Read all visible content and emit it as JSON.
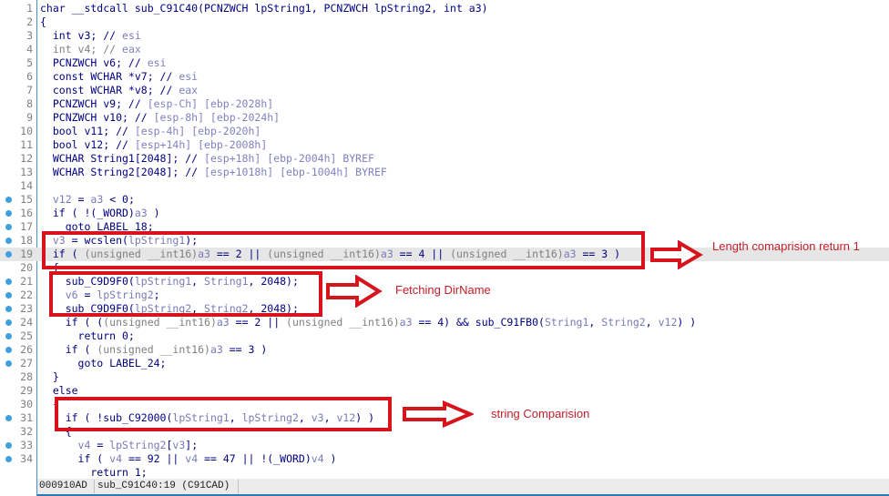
{
  "editor": {
    "lines": [
      {
        "n": "1",
        "bp": false,
        "hl": false,
        "parts": [
          [
            "kw",
            "char __stdcall sub_C91C40(PCNZWCH lpString1, PCNZWCH lpString2, int a3)"
          ]
        ]
      },
      {
        "n": "2",
        "bp": false,
        "hl": false,
        "parts": [
          [
            "kw",
            "{"
          ]
        ]
      },
      {
        "n": "3",
        "bp": false,
        "hl": false,
        "parts": [
          [
            "kw",
            "  int v3; // "
          ],
          [
            "cm",
            "esi"
          ]
        ]
      },
      {
        "n": "4",
        "bp": false,
        "hl": false,
        "parts": [
          [
            "dim",
            "  int v4; // "
          ],
          [
            "cm",
            "eax"
          ]
        ]
      },
      {
        "n": "5",
        "bp": false,
        "hl": false,
        "parts": [
          [
            "kw",
            "  PCNZWCH v6; // "
          ],
          [
            "cm",
            "esi"
          ]
        ]
      },
      {
        "n": "6",
        "bp": false,
        "hl": false,
        "parts": [
          [
            "kw",
            "  const WCHAR *v7; // "
          ],
          [
            "cm",
            "esi"
          ]
        ]
      },
      {
        "n": "7",
        "bp": false,
        "hl": false,
        "parts": [
          [
            "kw",
            "  const WCHAR *v8; // "
          ],
          [
            "cm",
            "eax"
          ]
        ]
      },
      {
        "n": "8",
        "bp": false,
        "hl": false,
        "parts": [
          [
            "kw",
            "  PCNZWCH v9; // "
          ],
          [
            "cm",
            "[esp-Ch] [ebp-2028h]"
          ]
        ]
      },
      {
        "n": "9",
        "bp": false,
        "hl": false,
        "parts": [
          [
            "kw",
            "  PCNZWCH v10; // "
          ],
          [
            "cm",
            "[esp-8h] [ebp-2024h]"
          ]
        ]
      },
      {
        "n": "10",
        "bp": false,
        "hl": false,
        "parts": [
          [
            "kw",
            "  bool v11; // "
          ],
          [
            "cm",
            "[esp-4h] [ebp-2020h]"
          ]
        ]
      },
      {
        "n": "11",
        "bp": false,
        "hl": false,
        "parts": [
          [
            "kw",
            "  bool v12; // "
          ],
          [
            "cm",
            "[esp+14h] [ebp-2008h]"
          ]
        ]
      },
      {
        "n": "12",
        "bp": false,
        "hl": false,
        "parts": [
          [
            "kw",
            "  WCHAR String1[2048]; // "
          ],
          [
            "cm",
            "[esp+18h] [ebp-2004h] BYREF"
          ]
        ]
      },
      {
        "n": "13",
        "bp": false,
        "hl": false,
        "parts": [
          [
            "kw",
            "  WCHAR String2[2048]; // "
          ],
          [
            "cm",
            "[esp+1018h] [ebp-1004h] BYREF"
          ]
        ]
      },
      {
        "n": "14",
        "bp": false,
        "hl": false,
        "parts": [
          [
            "kw",
            ""
          ]
        ]
      },
      {
        "n": "15",
        "bp": true,
        "hl": false,
        "parts": [
          [
            "var",
            "  v12"
          ],
          [
            "kw",
            " = "
          ],
          [
            "var",
            "a3"
          ],
          [
            "kw",
            " < 0;"
          ]
        ]
      },
      {
        "n": "16",
        "bp": true,
        "hl": false,
        "parts": [
          [
            "kw",
            "  if ( !(_WORD)"
          ],
          [
            "var",
            "a3"
          ],
          [
            "kw",
            " )"
          ]
        ]
      },
      {
        "n": "17",
        "bp": true,
        "hl": false,
        "parts": [
          [
            "kw",
            "    goto LABEL_18;"
          ]
        ]
      },
      {
        "n": "18",
        "bp": true,
        "hl": false,
        "parts": [
          [
            "var",
            "  v3"
          ],
          [
            "kw",
            " = wcslen("
          ],
          [
            "var",
            "lpString1"
          ],
          [
            "kw",
            ");"
          ]
        ]
      },
      {
        "n": "19",
        "bp": true,
        "hl": true,
        "parts": [
          [
            "kw",
            "  if ( "
          ],
          [
            "dim",
            "(unsigned __int16)"
          ],
          [
            "var",
            "a3"
          ],
          [
            "kw",
            " == 2 || "
          ],
          [
            "dim",
            "(unsigned __int16)"
          ],
          [
            "var",
            "a3"
          ],
          [
            "kw",
            " == 4 || "
          ],
          [
            "dim",
            "(unsigned __int16)"
          ],
          [
            "var",
            "a3"
          ],
          [
            "kw",
            " == 3 )"
          ]
        ]
      },
      {
        "n": "20",
        "bp": false,
        "hl": false,
        "parts": [
          [
            "kw",
            "  {"
          ]
        ]
      },
      {
        "n": "21",
        "bp": true,
        "hl": false,
        "parts": [
          [
            "kw",
            "    sub_C9D9F0("
          ],
          [
            "var",
            "lpString1"
          ],
          [
            "kw",
            ", "
          ],
          [
            "var",
            "String1"
          ],
          [
            "kw",
            ", 2048);"
          ]
        ]
      },
      {
        "n": "22",
        "bp": true,
        "hl": false,
        "parts": [
          [
            "var",
            "    v6"
          ],
          [
            "kw",
            " = "
          ],
          [
            "var",
            "lpString2"
          ],
          [
            "kw",
            ";"
          ]
        ]
      },
      {
        "n": "23",
        "bp": true,
        "hl": false,
        "parts": [
          [
            "kw",
            "    sub_C9D9F0("
          ],
          [
            "var",
            "lpString2"
          ],
          [
            "kw",
            ", "
          ],
          [
            "var",
            "String2"
          ],
          [
            "kw",
            ", 2048);"
          ]
        ]
      },
      {
        "n": "24",
        "bp": true,
        "hl": false,
        "parts": [
          [
            "kw",
            "    if ( ("
          ],
          [
            "dim",
            "(unsigned __int16)"
          ],
          [
            "var",
            "a3"
          ],
          [
            "kw",
            " == 2 || "
          ],
          [
            "dim",
            "(unsigned __int16)"
          ],
          [
            "var",
            "a3"
          ],
          [
            "kw",
            " == 4) && sub_C91FB0("
          ],
          [
            "var",
            "String1"
          ],
          [
            "kw",
            ", "
          ],
          [
            "var",
            "String2"
          ],
          [
            "kw",
            ", "
          ],
          [
            "var",
            "v12"
          ],
          [
            "kw",
            ") )"
          ]
        ]
      },
      {
        "n": "25",
        "bp": true,
        "hl": false,
        "parts": [
          [
            "kw",
            "      return 0;"
          ]
        ]
      },
      {
        "n": "26",
        "bp": true,
        "hl": false,
        "parts": [
          [
            "kw",
            "    if ( "
          ],
          [
            "dim",
            "(unsigned __int16)"
          ],
          [
            "var",
            "a3"
          ],
          [
            "kw",
            " == 3 )"
          ]
        ]
      },
      {
        "n": "27",
        "bp": true,
        "hl": false,
        "parts": [
          [
            "kw",
            "      goto LABEL_24;"
          ]
        ]
      },
      {
        "n": "28",
        "bp": false,
        "hl": false,
        "parts": [
          [
            "kw",
            "  }"
          ]
        ]
      },
      {
        "n": "29",
        "bp": false,
        "hl": false,
        "parts": [
          [
            "kw",
            "  else"
          ]
        ]
      },
      {
        "n": "30",
        "bp": false,
        "hl": false,
        "parts": [
          [
            "kw",
            "  {"
          ]
        ]
      },
      {
        "n": "31",
        "bp": true,
        "hl": false,
        "parts": [
          [
            "kw",
            "    if ( !sub_C92000("
          ],
          [
            "var",
            "lpString1"
          ],
          [
            "kw",
            ", "
          ],
          [
            "var",
            "lpString2"
          ],
          [
            "kw",
            ", "
          ],
          [
            "var",
            "v3"
          ],
          [
            "kw",
            ", "
          ],
          [
            "var",
            "v12"
          ],
          [
            "kw",
            ") )"
          ]
        ]
      },
      {
        "n": "32",
        "bp": false,
        "hl": false,
        "parts": [
          [
            "kw",
            "    {"
          ]
        ]
      },
      {
        "n": "33",
        "bp": true,
        "hl": false,
        "parts": [
          [
            "var",
            "      v4"
          ],
          [
            "kw",
            " = "
          ],
          [
            "var",
            "lpString2"
          ],
          [
            "kw",
            "["
          ],
          [
            "var",
            "v3"
          ],
          [
            "kw",
            "];"
          ]
        ]
      },
      {
        "n": "34",
        "bp": true,
        "hl": false,
        "parts": [
          [
            "kw",
            "      if ( "
          ],
          [
            "var",
            "v4"
          ],
          [
            "kw",
            " == 92 || "
          ],
          [
            "var",
            "v4"
          ],
          [
            "kw",
            " == 47 || !(_WORD)"
          ],
          [
            "var",
            "v4"
          ],
          [
            "kw",
            " )"
          ]
        ]
      },
      {
        "n": "",
        "bp": false,
        "hl": false,
        "parts": [
          [
            "kw",
            "        return 1;"
          ]
        ]
      }
    ]
  },
  "annotations": {
    "length_note": "Length comaprision return 1",
    "dirname_note": "Fetching DirName",
    "string_note": "string Comparision",
    "color": "#d7141c"
  },
  "status_bar": {
    "address": "000910AD",
    "location": "sub_C91C40:19 (C91CAD)"
  }
}
